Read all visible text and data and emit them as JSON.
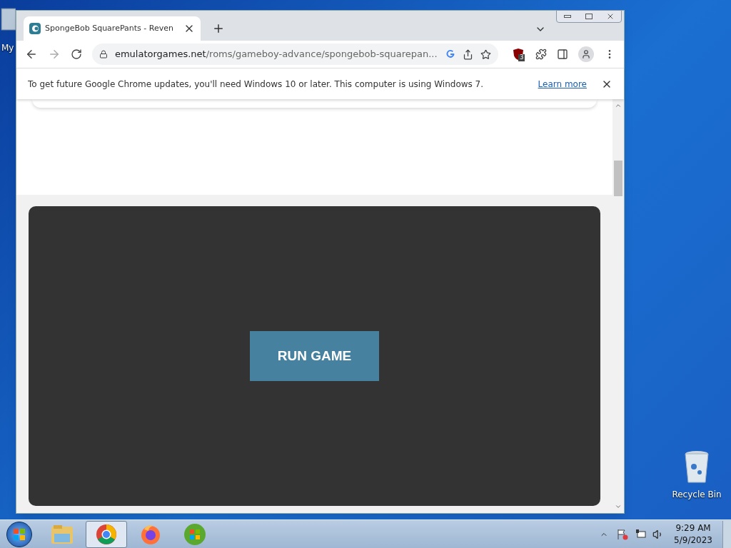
{
  "desktop": {
    "icons": [
      {
        "kind": "computer",
        "label": "My"
      },
      {
        "kind": "bin",
        "label": "Recycle Bin"
      }
    ]
  },
  "browser": {
    "tab": {
      "title": "SpongeBob SquarePants - Reven",
      "selected": true
    },
    "url": {
      "host": "emulatorgames.net",
      "path": "/roms/gameboy-advance/spongebob-squarepan..."
    },
    "extension_badge": "3",
    "infobar": {
      "message": "To get future Google Chrome updates, you'll need Windows 10 or later. This computer is using Windows 7.",
      "link": "Learn more"
    },
    "page": {
      "button": "RUN GAME"
    }
  },
  "taskbar": {
    "apps": [
      {
        "kind": "explorer",
        "selected": false
      },
      {
        "kind": "chrome",
        "selected": true
      },
      {
        "kind": "firefox",
        "selected": false
      },
      {
        "kind": "windows",
        "selected": false
      }
    ],
    "time": "9:29 AM",
    "date": "5/9/2023"
  }
}
